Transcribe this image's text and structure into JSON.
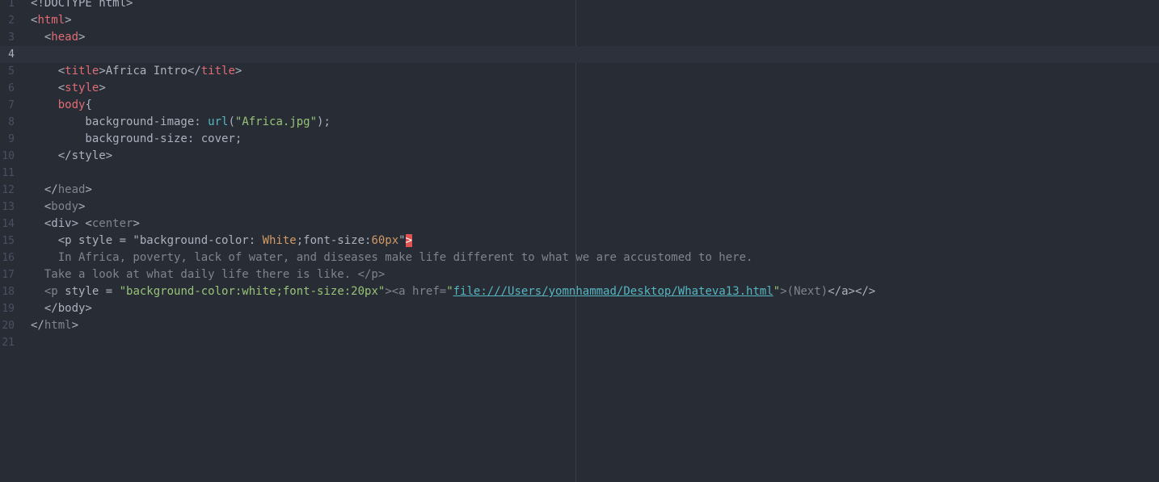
{
  "editor": {
    "lines": [
      {
        "n": "1",
        "tokens": [
          {
            "t": "<!DOCTYPE html>",
            "c": "t-punct"
          }
        ]
      },
      {
        "n": "2",
        "tokens": [
          {
            "t": "<",
            "c": "t-punct"
          },
          {
            "t": "html",
            "c": "t-tag"
          },
          {
            "t": ">",
            "c": "t-punct"
          }
        ]
      },
      {
        "n": "3",
        "tokens": [
          {
            "t": "  <",
            "c": "t-punct"
          },
          {
            "t": "head",
            "c": "t-tag"
          },
          {
            "t": ">",
            "c": "t-punct"
          }
        ]
      },
      {
        "n": "4",
        "cursor": true,
        "tokens": []
      },
      {
        "n": "5",
        "tokens": [
          {
            "t": "    <",
            "c": "t-punct"
          },
          {
            "t": "title",
            "c": "t-tag"
          },
          {
            "t": ">Africa Intro</",
            "c": "t-punct"
          },
          {
            "t": "title",
            "c": "t-tag"
          },
          {
            "t": ">",
            "c": "t-punct"
          }
        ]
      },
      {
        "n": "6",
        "tokens": [
          {
            "t": "    <",
            "c": "t-punct"
          },
          {
            "t": "style",
            "c": "t-tag"
          },
          {
            "t": ">",
            "c": "t-punct"
          }
        ]
      },
      {
        "n": "7",
        "tokens": [
          {
            "t": "    ",
            "c": "t-punct"
          },
          {
            "t": "body",
            "c": "t-tag"
          },
          {
            "t": "{",
            "c": "t-punct"
          }
        ]
      },
      {
        "n": "8",
        "tokens": [
          {
            "t": "        background-image: ",
            "c": "t-punct"
          },
          {
            "t": "url",
            "c": "t-fn"
          },
          {
            "t": "(",
            "c": "t-punct"
          },
          {
            "t": "\"Africa.jpg\"",
            "c": "t-str"
          },
          {
            "t": ");",
            "c": "t-punct"
          }
        ]
      },
      {
        "n": "9",
        "tokens": [
          {
            "t": "        background-size: cover;",
            "c": "t-punct"
          }
        ]
      },
      {
        "n": "10",
        "tokens": [
          {
            "t": "    </style>",
            "c": "t-punct"
          }
        ]
      },
      {
        "n": "11",
        "tokens": []
      },
      {
        "n": "12",
        "tokens": [
          {
            "t": "  </",
            "c": "t-punct"
          },
          {
            "t": "head",
            "c": "t-dim"
          },
          {
            "t": ">",
            "c": "t-punct"
          }
        ]
      },
      {
        "n": "13",
        "tokens": [
          {
            "t": "  <",
            "c": "t-punct"
          },
          {
            "t": "body",
            "c": "t-dim"
          },
          {
            "t": ">",
            "c": "t-punct"
          }
        ]
      },
      {
        "n": "14",
        "tokens": [
          {
            "t": "  <div> <",
            "c": "t-punct"
          },
          {
            "t": "center",
            "c": "t-dim"
          },
          {
            "t": ">",
            "c": "t-punct"
          }
        ]
      },
      {
        "n": "15",
        "tokens": [
          {
            "t": "    <p style = \"background-color: ",
            "c": "t-punct"
          },
          {
            "t": "White",
            "c": "t-num"
          },
          {
            "t": ";font-size:",
            "c": "t-punct"
          },
          {
            "t": "60px",
            "c": "t-num"
          },
          {
            "t": "\"",
            "c": "t-punct"
          },
          {
            "t": ">",
            "c": "t-err"
          }
        ]
      },
      {
        "n": "16",
        "tokens": [
          {
            "t": "    In Africa, poverty, lack of water, and diseases make life different to what we are accustomed to here.",
            "c": "t-dim"
          }
        ]
      },
      {
        "n": "17",
        "tokens": [
          {
            "t": "  Take a look at what daily life there is like. </p>",
            "c": "t-dim"
          }
        ]
      },
      {
        "n": "18",
        "tokens": [
          {
            "t": "  <p ",
            "c": "t-dim"
          },
          {
            "t": "style = ",
            "c": "t-punct"
          },
          {
            "t": "\"background-color:white;font-size:20px\"",
            "c": "t-str"
          },
          {
            "t": "><a href=",
            "c": "t-dim"
          },
          {
            "t": "\"",
            "c": "t-str"
          },
          {
            "t": "file:///Users/yomnhammad/Desktop/Whateva13.html",
            "c": "t-link"
          },
          {
            "t": "\"",
            "c": "t-str"
          },
          {
            "t": ">(Next)",
            "c": "t-dim"
          },
          {
            "t": "</a></>",
            "c": "t-punct"
          }
        ]
      },
      {
        "n": "19",
        "tokens": [
          {
            "t": "  </body>",
            "c": "t-punct"
          }
        ]
      },
      {
        "n": "20",
        "tokens": [
          {
            "t": "</",
            "c": "t-punct"
          },
          {
            "t": "html",
            "c": "t-dim"
          },
          {
            "t": ">",
            "c": "t-punct"
          }
        ]
      },
      {
        "n": "21",
        "tokens": []
      }
    ]
  }
}
